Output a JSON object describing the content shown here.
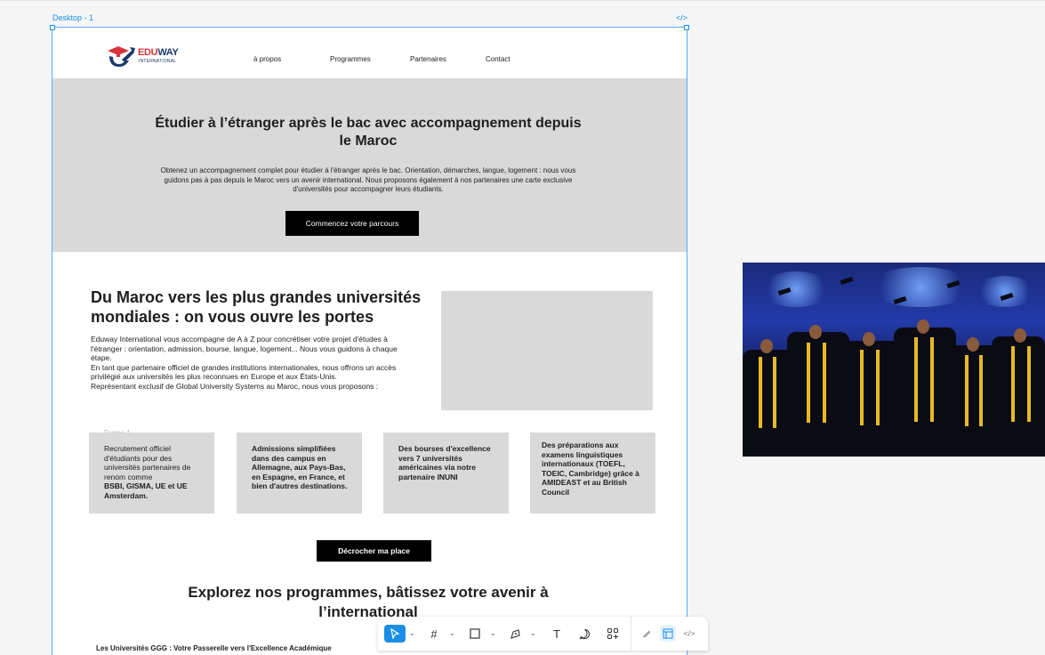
{
  "canvas": {
    "frame_name": "Desktop - 1",
    "code_toggle_icon": "code-icon"
  },
  "nav": {
    "logo": {
      "brand_part1": "EDU",
      "brand_part2": "WAY",
      "sub": "INTERNATIONAL",
      "icon": "graduation-arrow-logo"
    },
    "links": [
      "à propos",
      "Programmes",
      "Partenaires",
      "Contact"
    ]
  },
  "hero": {
    "title": "Étudier à l’étranger après le bac avec accompagnement depuis le Maroc",
    "text": "Obtenez un accompagnement complet pour étudier à l'étranger après le bac. Orientation, démarches, langue, logement : nous vous guidons pas à pas depuis le Maroc vers un avenir international. Nous proposons également à nos partenaires une carte exclusive d'universités pour accompagner leurs étudiants.",
    "cta": "Commencez votre parcours"
  },
  "section2": {
    "title": "Du Maroc vers les plus grandes universités mondiales : on vous ouvre les portes",
    "paragraphs": [
      "Eduway International vous accompagne de A à Z pour concrétiser votre projet d'études à l'étranger : orientation, admission, bourse, langue, logement... Nous vous guidons à chaque étape.",
      "En tant que partenaire officiel de grandes institutions internationales, nous offrons un accès privilégié aux universités les plus reconnues en Europe et aux États-Unis.",
      "Représentant exclusif de Global University Systems au Maroc, nous vous proposons :"
    ],
    "frame_label": "Frame 1",
    "cards": [
      {
        "text": "Recrutement officiel d'étudiants pour des universités partenaires de renom comme",
        "bold": "BSBI, GISMA, UE et UE Amsterdam."
      },
      {
        "text": "",
        "bold": "Admissions simplifiées dans des campus en Allemagne, aux Pays-Bas, en Espagne, en France, et bien d'autres destinations."
      },
      {
        "text": "",
        "bold": "Des bourses d'excellence vers 7 universités américaines via notre partenaire INUNI"
      },
      {
        "text": "",
        "bold": "Des préparations aux examens linguistiques internationaux (TOEFL, TOEIC, Cambridge) grâce à AMIDEAST et au British Council"
      }
    ],
    "cta": "Décrocher ma place"
  },
  "section3": {
    "title": "Explorez nos programmes, bâtissez votre avenir à l’international",
    "line": "Les Universités GGG : Votre Passerelle vers l'Excellence Académique"
  },
  "photo": {
    "subject": "graduation-ceremony-photo"
  },
  "toolbar": {
    "tools": [
      "move-tool-icon",
      "frame-tool-icon",
      "rectangle-tool-icon",
      "pen-tool-icon",
      "text-tool-icon",
      "comment-tool-icon",
      "actions-tool-icon"
    ],
    "text_tool_label": "T",
    "side_tools": [
      "draw-mode-icon",
      "design-mode-icon",
      "dev-mode-icon"
    ]
  },
  "colors": {
    "selection": "#1b8ee8",
    "hero_bg": "#d9d9d9",
    "brand_red": "#d7333a",
    "brand_navy": "#1a3a6b",
    "button_bg": "#000000"
  }
}
